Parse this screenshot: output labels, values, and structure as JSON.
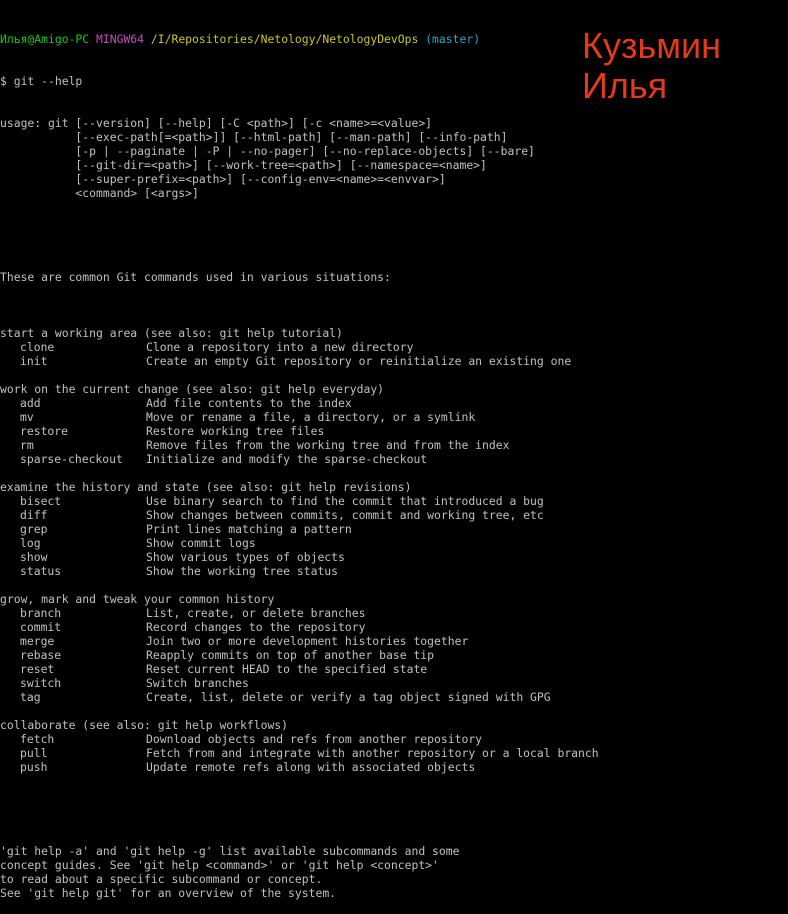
{
  "prompt": {
    "user_host": "Илья@Amigo-PC",
    "shell": "MINGW64",
    "path": "/I/Repositories/Netology/NetologyDevOps",
    "branch": "(master)"
  },
  "command_line": "$ git --help",
  "usage_lines": [
    "usage: git [--version] [--help] [-C <path>] [-c <name>=<value>]",
    "           [--exec-path[=<path>]] [--html-path] [--man-path] [--info-path]",
    "           [-p | --paginate | -P | --no-pager] [--no-replace-objects] [--bare]",
    "           [--git-dir=<path>] [--work-tree=<path>] [--namespace=<name>]",
    "           [--super-prefix=<path>] [--config-env=<name>=<envvar>]",
    "           <command> [<args>]"
  ],
  "intro": "These are common Git commands used in various situations:",
  "sections": [
    {
      "heading": "start a working area (see also: git help tutorial)",
      "commands": [
        {
          "name": "clone",
          "desc": "Clone a repository into a new directory"
        },
        {
          "name": "init",
          "desc": "Create an empty Git repository or reinitialize an existing one"
        }
      ]
    },
    {
      "heading": "work on the current change (see also: git help everyday)",
      "commands": [
        {
          "name": "add",
          "desc": "Add file contents to the index"
        },
        {
          "name": "mv",
          "desc": "Move or rename a file, a directory, or a symlink"
        },
        {
          "name": "restore",
          "desc": "Restore working tree files"
        },
        {
          "name": "rm",
          "desc": "Remove files from the working tree and from the index"
        },
        {
          "name": "sparse-checkout",
          "desc": "Initialize and modify the sparse-checkout"
        }
      ]
    },
    {
      "heading": "examine the history and state (see also: git help revisions)",
      "commands": [
        {
          "name": "bisect",
          "desc": "Use binary search to find the commit that introduced a bug"
        },
        {
          "name": "diff",
          "desc": "Show changes between commits, commit and working tree, etc"
        },
        {
          "name": "grep",
          "desc": "Print lines matching a pattern"
        },
        {
          "name": "log",
          "desc": "Show commit logs"
        },
        {
          "name": "show",
          "desc": "Show various types of objects"
        },
        {
          "name": "status",
          "desc": "Show the working tree status"
        }
      ]
    },
    {
      "heading": "grow, mark and tweak your common history",
      "commands": [
        {
          "name": "branch",
          "desc": "List, create, or delete branches"
        },
        {
          "name": "commit",
          "desc": "Record changes to the repository"
        },
        {
          "name": "merge",
          "desc": "Join two or more development histories together"
        },
        {
          "name": "rebase",
          "desc": "Reapply commits on top of another base tip"
        },
        {
          "name": "reset",
          "desc": "Reset current HEAD to the specified state"
        },
        {
          "name": "switch",
          "desc": "Switch branches"
        },
        {
          "name": "tag",
          "desc": "Create, list, delete or verify a tag object signed with GPG"
        }
      ]
    },
    {
      "heading": "collaborate (see also: git help workflows)",
      "commands": [
        {
          "name": "fetch",
          "desc": "Download objects and refs from another repository"
        },
        {
          "name": "pull",
          "desc": "Fetch from and integrate with another repository or a local branch"
        },
        {
          "name": "push",
          "desc": "Update remote refs along with associated objects"
        }
      ]
    }
  ],
  "footer_lines": [
    "'git help -a' and 'git help -g' list available subcommands and some",
    "concept guides. See 'git help <command>' or 'git help <concept>'",
    "to read about a specific subcommand or concept.",
    "See 'git help git' for an overview of the system."
  ],
  "overlay": {
    "line1": "Кузьмин",
    "line2": "Илья",
    "color": "#e23a1a"
  },
  "colors": {
    "background": "#000000",
    "text": "#c0c0c0",
    "user_host": "#19c819",
    "shell": "#c24ac2",
    "path": "#c8c81c",
    "branch": "#23a8c8"
  }
}
